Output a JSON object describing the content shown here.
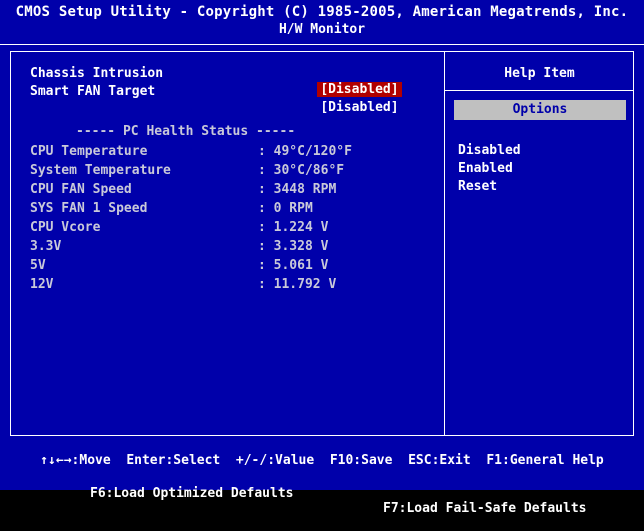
{
  "header": {
    "title": "CMOS Setup Utility - Copyright (C) 1985-2005, American Megatrends, Inc.",
    "subtitle": "H/W Monitor"
  },
  "settings": [
    {
      "label": "Chassis Intrusion",
      "value": "[Disabled]",
      "selected": true
    },
    {
      "label": "Smart FAN Target",
      "value": "[Disabled]",
      "selected": false
    }
  ],
  "pc_health": {
    "heading": "----- PC Health Status -----",
    "rows": [
      {
        "label": "CPU Temperature",
        "value": ": 49°C/120°F"
      },
      {
        "label": "System Temperature",
        "value": ": 30°C/86°F"
      },
      {
        "label": "CPU FAN Speed",
        "value": ": 3448 RPM"
      },
      {
        "label": "SYS FAN 1 Speed",
        "value": ": 0 RPM"
      },
      {
        "label": "CPU Vcore",
        "value": ": 1.224 V"
      },
      {
        "label": "3.3V",
        "value": ": 3.328 V"
      },
      {
        "label": "5V",
        "value": ": 5.061 V"
      },
      {
        "label": "12V",
        "value": ": 11.792 V"
      }
    ]
  },
  "help": {
    "title": "Help Item",
    "options_label": "Options",
    "options": [
      "Disabled",
      "Enabled",
      "Reset"
    ]
  },
  "footer": {
    "line1": "↑↓←→:Move  Enter:Select  +/-/:Value  F10:Save  ESC:Exit  F1:General Help",
    "line2_left": "F6:Load Optimized Defaults",
    "line2_right": "F7:Load Fail-Safe Defaults"
  },
  "colors": {
    "background": "#0000aa",
    "selected": "#b00000",
    "options_bar": "#c0c0c0"
  }
}
